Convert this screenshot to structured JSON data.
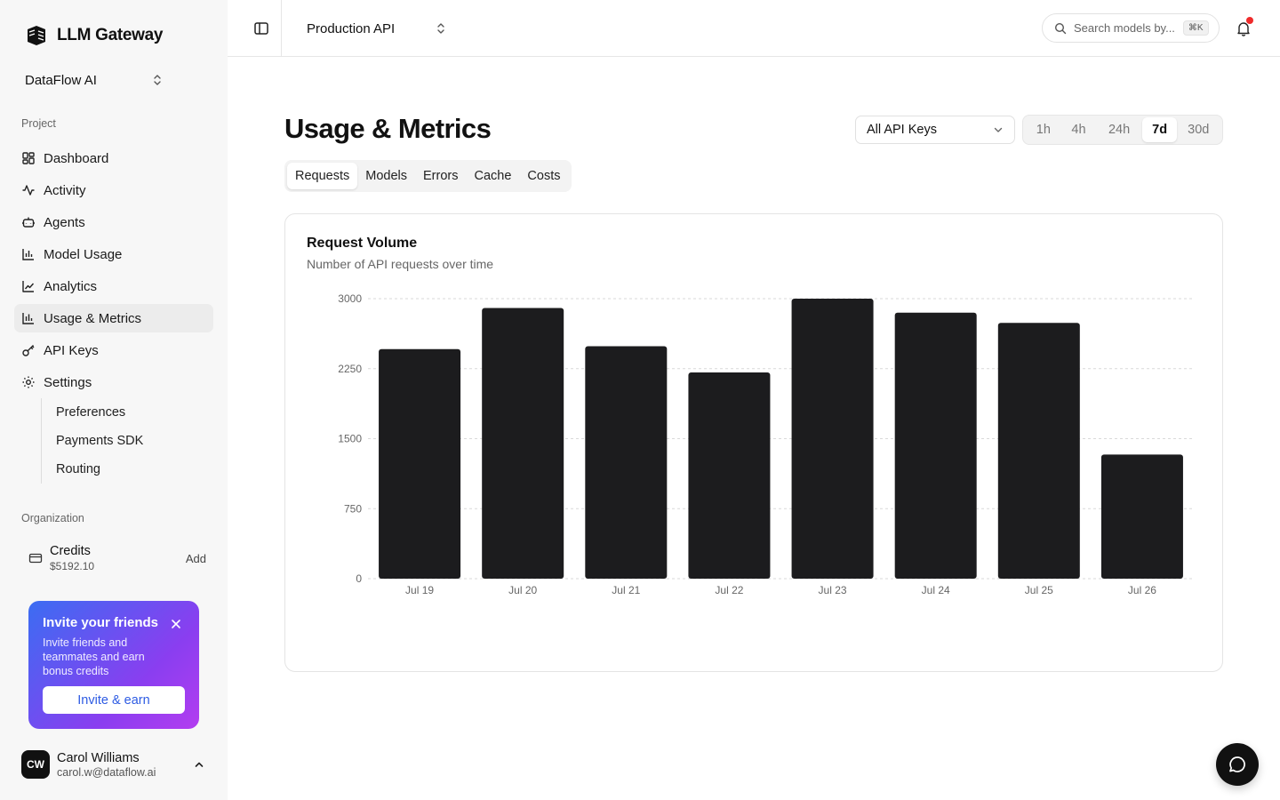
{
  "app": {
    "name": "LLM Gateway"
  },
  "org_switcher": {
    "label": "DataFlow AI"
  },
  "sidebar": {
    "project_label": "Project",
    "items": [
      {
        "label": "Dashboard",
        "icon": "dashboard-icon"
      },
      {
        "label": "Activity",
        "icon": "activity-icon"
      },
      {
        "label": "Agents",
        "icon": "bot-icon"
      },
      {
        "label": "Model Usage",
        "icon": "bar-chart-icon"
      },
      {
        "label": "Analytics",
        "icon": "line-chart-icon"
      },
      {
        "label": "Usage & Metrics",
        "icon": "bar-chart-icon",
        "active": true
      },
      {
        "label": "API Keys",
        "icon": "key-icon"
      },
      {
        "label": "Settings",
        "icon": "gear-icon"
      }
    ],
    "sub_items": [
      "Preferences",
      "Payments SDK",
      "Routing"
    ],
    "organization_label": "Organization",
    "credits": {
      "title": "Credits",
      "amount": "$5192.10",
      "action": "Add"
    },
    "invite": {
      "title": "Invite your friends",
      "text": "Invite friends and teammates and earn bonus credits",
      "button": "Invite & earn"
    },
    "user": {
      "initials": "CW",
      "name": "Carol Williams",
      "email": "carol.w@dataflow.ai"
    }
  },
  "header": {
    "project": "Production API",
    "search_placeholder": "Search models by...",
    "search_shortcut": "⌘K"
  },
  "main": {
    "title": "Usage & Metrics",
    "api_key_filter": "All API Keys",
    "ranges": [
      {
        "label": "1h",
        "active": false
      },
      {
        "label": "4h",
        "active": false
      },
      {
        "label": "24h",
        "active": false
      },
      {
        "label": "7d",
        "active": true
      },
      {
        "label": "30d",
        "active": false
      }
    ],
    "tabs": [
      {
        "label": "Requests",
        "active": true
      },
      {
        "label": "Models",
        "active": false
      },
      {
        "label": "Errors",
        "active": false
      },
      {
        "label": "Cache",
        "active": false
      },
      {
        "label": "Costs",
        "active": false
      }
    ],
    "card": {
      "title": "Request Volume",
      "subtitle": "Number of API requests over time"
    }
  },
  "colors": {
    "bar": "#1c1c1e",
    "grid": "#d9d9d9",
    "accent_notification": "#ef2b2b"
  },
  "chart_data": {
    "type": "bar",
    "title": "Request Volume",
    "subtitle": "Number of API requests over time",
    "categories": [
      "Jul 19",
      "Jul 20",
      "Jul 21",
      "Jul 22",
      "Jul 23",
      "Jul 24",
      "Jul 25",
      "Jul 26"
    ],
    "values": [
      2460,
      2900,
      2490,
      2210,
      3000,
      2850,
      2740,
      1330
    ],
    "yticks": [
      0,
      750,
      1500,
      2250,
      3000
    ],
    "ylim": [
      0,
      3000
    ],
    "grid": true
  }
}
